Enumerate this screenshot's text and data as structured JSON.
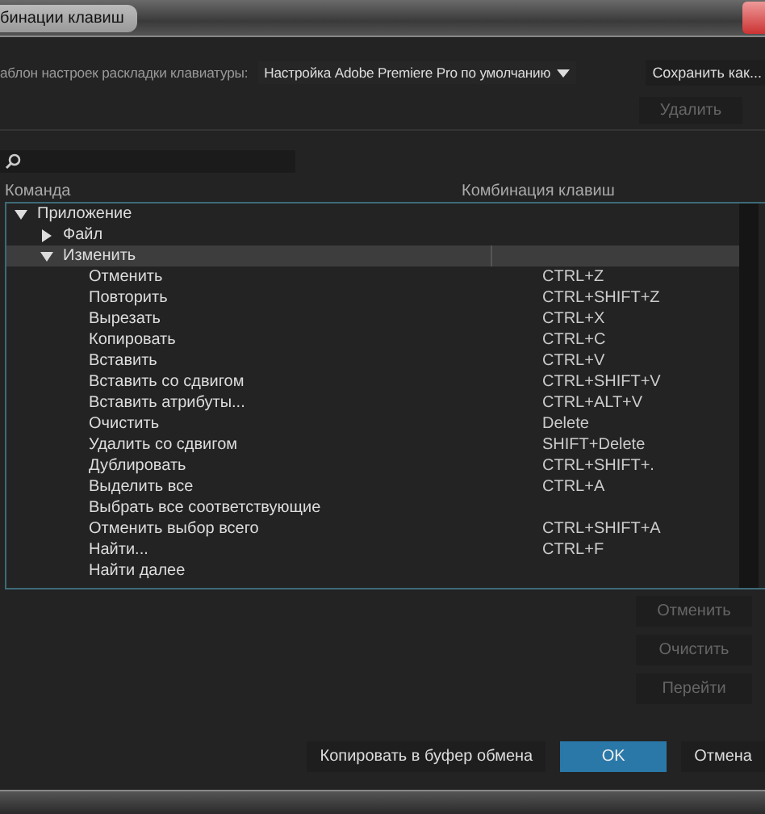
{
  "window": {
    "title": "бинации клавиш"
  },
  "preset": {
    "label": "аблон настроек раскладки клавиатуры:",
    "value": "Настройка Adobe Premiere Pro по умолчанию",
    "save_button": "Сохранить как...",
    "delete_button": {
      "label": "Удалить",
      "disabled": true
    }
  },
  "table": {
    "columns": [
      "Команда",
      "Комбинация клавиш"
    ],
    "rows": [
      {
        "label": "Приложение",
        "expanded": true,
        "selected": false,
        "children": [
          {
            "label": "Файл",
            "expanded": false,
            "selected": false
          },
          {
            "label": "Изменить",
            "expanded": true,
            "selected": true,
            "children": [
              {
                "label": "Отменить",
                "shortcut": "CTRL+Z",
                "selected": false
              },
              {
                "label": "Повторить",
                "shortcut": "CTRL+SHIFT+Z",
                "selected": false
              },
              {
                "label": "Вырезать",
                "shortcut": "CTRL+X",
                "selected": false
              },
              {
                "label": "Копировать",
                "shortcut": "CTRL+C",
                "selected": false
              },
              {
                "label": "Вставить",
                "shortcut": "CTRL+V",
                "selected": false
              },
              {
                "label": "Вставить со сдвигом",
                "shortcut": "CTRL+SHIFT+V",
                "selected": false
              },
              {
                "label": "Вставить атрибуты...",
                "shortcut": "CTRL+ALT+V",
                "selected": false
              },
              {
                "label": "Очистить",
                "shortcut": "Delete",
                "selected": false
              },
              {
                "label": "Удалить со сдвигом",
                "shortcut": "SHIFT+Delete",
                "selected": false
              },
              {
                "label": "Дублировать",
                "shortcut": "CTRL+SHIFT+.",
                "selected": false
              },
              {
                "label": "Выделить все",
                "shortcut": "CTRL+A",
                "selected": false
              },
              {
                "label": "Выбрать все соответствующие",
                "selected": false
              },
              {
                "label": "Отменить выбор всего",
                "shortcut": "CTRL+SHIFT+A",
                "selected": false
              },
              {
                "label": "Найти...",
                "shortcut": "CTRL+F",
                "selected": false
              },
              {
                "label": "Найти далее",
                "selected": false
              }
            ]
          }
        ]
      }
    ]
  },
  "side_buttons": [
    {
      "label": "Отменить",
      "disabled": true
    },
    {
      "label": "Очистить",
      "disabled": true
    },
    {
      "label": "Перейти",
      "disabled": true
    }
  ],
  "footer_buttons": [
    {
      "label": "Копировать в буфер обмена",
      "kind": "normal"
    },
    {
      "label": "OK",
      "kind": "primary"
    },
    {
      "label": "Отмена",
      "kind": "normal"
    }
  ]
}
